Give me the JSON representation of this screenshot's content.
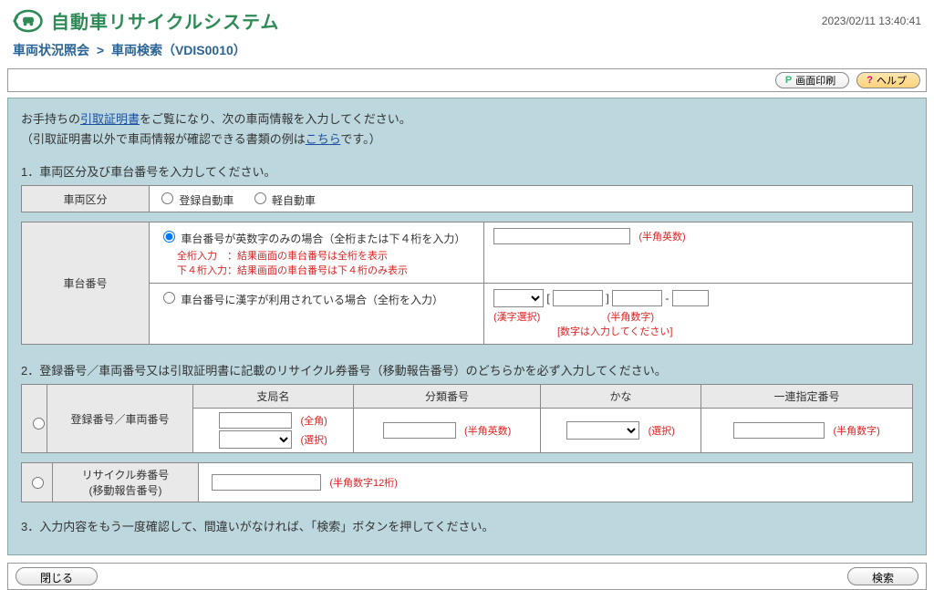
{
  "brand": {
    "title": "自動車リサイクルシステム"
  },
  "timestamp": "2023/02/11 13:40:41",
  "breadcrumb": {
    "part1": "車両状況照会",
    "sep": ">",
    "part2": "車両検索（VDIS0010）"
  },
  "toolbar": {
    "print_label": "画面印刷",
    "help_label": "ヘルプ"
  },
  "intro": {
    "line1_a": "お手持ちの",
    "line1_link": "引取証明書",
    "line1_b": "をご覧になり、次の車両情報を入力してください。",
    "line2_a": "（引取証明書以外で車両情報が確認できる書類の例は",
    "line2_link": "こちら",
    "line2_b": "です。）"
  },
  "section1": {
    "title": "1．車両区分及び車台番号を入力してください。",
    "vehicle_class_label": "車両区分",
    "opt_registered": "登録自動車",
    "opt_kei": "軽自動車",
    "chassis_label": "車台番号",
    "chassis_opt1": "車台番号が英数字のみの場合（全桁または下４桁を入力）",
    "chassis_note1": "全桁入力　：結果画面の車台番号は全桁を表示",
    "chassis_note2": "下４桁入力：結果画面の車台番号は下４桁のみ表示",
    "chassis_hint1": "(半角英数)",
    "chassis_opt2": "車台番号に漢字が利用されている場合（全桁を入力）",
    "bracket_l": "[",
    "bracket_r": "]",
    "dash": "-",
    "chassis_hint2a": "(漢字選択)",
    "chassis_hint2b": "(半角数字)",
    "chassis_hint2c": "[数字は入力してください]"
  },
  "section2": {
    "title": "2．登録番号／車両番号又は引取証明書に記載のリサイクル券番号（移動報告番号）のどちらかを必ず入力してください。",
    "reg_label": "登録番号／車両番号",
    "col_branch": "支局名",
    "col_class": "分類番号",
    "col_kana": "かな",
    "col_serial": "一連指定番号",
    "hint_full": "(全角)",
    "hint_select": "(選択)",
    "hint_halfalnum": "(半角英数)",
    "hint_select2": "(選択)",
    "hint_halfnum": "(半角数字)",
    "recycle_label_a": "リサイクル券番号",
    "recycle_label_b": "(移動報告番号)",
    "recycle_hint": "(半角数字12桁)"
  },
  "section3": {
    "title": "3．入力内容をもう一度確認して、間違いがなければ、「検索」ボタンを押してください。"
  },
  "footer": {
    "close": "閉じる",
    "search": "検索"
  }
}
